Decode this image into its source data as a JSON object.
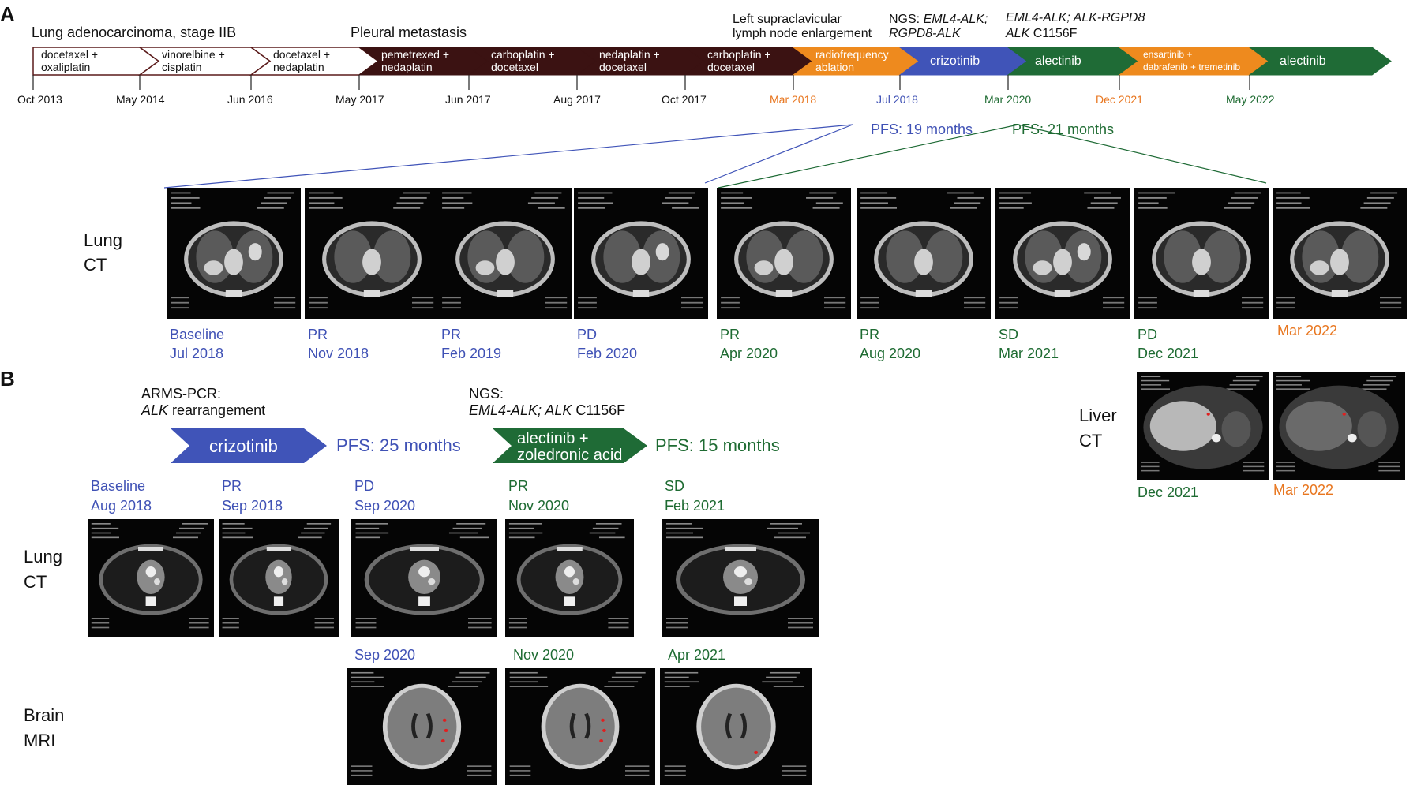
{
  "colors": {
    "brown": "#3b1212",
    "blue": "#4054b8",
    "green": "#1f6b36",
    "orange": "#ee8a1e",
    "blue_text": "#3f51b5",
    "green_text": "#1e6b32",
    "orange_text": "#e8761f"
  },
  "panel_a": {
    "label": "A",
    "header_labels": {
      "diagnosis": "Lung adenocarcinoma, stage IIB",
      "pleural": "Pleural metastasis",
      "lymph1": "Left supraclavicular",
      "lymph2": "lymph node enlargement",
      "ngs1_prefix": "NGS: ",
      "ngs1_gene": "EML4-ALK;",
      "ngs1_line2": "RGPD8-ALK",
      "ngs2_line1": "EML4-ALK; ALK-RGPD8",
      "ngs2_gene": "ALK",
      "ngs2_mut": " C1156F"
    },
    "arrows": [
      {
        "line1": "docetaxel +",
        "line2": "oxaliplatin",
        "style": "outline"
      },
      {
        "line1": "vinorelbine +",
        "line2": "cisplatin",
        "style": "outline"
      },
      {
        "line1": "docetaxel +",
        "line2": "nedaplatin",
        "style": "outline"
      },
      {
        "line1": "pemetrexed +",
        "line2": "nedaplatin",
        "style": "brown"
      },
      {
        "line1": "carboplatin +",
        "line2": "docetaxel",
        "style": "brown"
      },
      {
        "line1": "nedaplatin +",
        "line2": "docetaxel",
        "style": "brown"
      },
      {
        "line1": "carboplatin +",
        "line2": "docetaxel",
        "style": "brown"
      },
      {
        "line1": "radiofrequency",
        "line2": "ablation",
        "style": "orange"
      },
      {
        "line1": "crizotinib",
        "line2": "",
        "style": "blue"
      },
      {
        "line1": "alectinib",
        "line2": "",
        "style": "green"
      },
      {
        "line1": "ensartinib +",
        "line2": "dabrafenib + tremetinib",
        "style": "orange"
      },
      {
        "line1": "alectinib",
        "line2": "",
        "style": "green"
      }
    ],
    "dates": [
      {
        "label": "Oct 2013",
        "color": "black"
      },
      {
        "label": "May 2014",
        "color": "black"
      },
      {
        "label": "Jun 2016",
        "color": "black"
      },
      {
        "label": "May 2017",
        "color": "black"
      },
      {
        "label": "Jun 2017",
        "color": "black"
      },
      {
        "label": "Aug 2017",
        "color": "black"
      },
      {
        "label": "Oct 2017",
        "color": "black"
      },
      {
        "label": "Mar 2018",
        "color": "orange"
      },
      {
        "label": "Jul 2018",
        "color": "blue"
      },
      {
        "label": "Mar 2020",
        "color": "green"
      },
      {
        "label": "Dec 2021",
        "color": "orange"
      },
      {
        "label": "May 2022",
        "color": "green"
      }
    ],
    "pfs_blue": "PFS: 19 months",
    "pfs_green": "PFS: 21 months",
    "row_label_1": "Lung",
    "row_label_2": "CT",
    "scans": [
      {
        "status": "Baseline",
        "date": "Jul 2018",
        "color": "blue"
      },
      {
        "status": "PR",
        "date": "Nov 2018",
        "color": "blue"
      },
      {
        "status": "PR",
        "date": "Feb 2019",
        "color": "blue"
      },
      {
        "status": "PD",
        "date": "Feb 2020",
        "color": "blue"
      },
      {
        "status": "PR",
        "date": "Apr 2020",
        "color": "green"
      },
      {
        "status": "PR",
        "date": "Aug 2020",
        "color": "green"
      },
      {
        "status": "SD",
        "date": "Mar 2021",
        "color": "green"
      },
      {
        "status": "PD",
        "date": "Dec 2021",
        "color": "green"
      },
      {
        "status": "",
        "date": "Mar 2022",
        "color": "orange"
      }
    ]
  },
  "panel_b": {
    "label": "B",
    "arms_line1": "ARMS-PCR:",
    "arms_gene": "ALK",
    "arms_rest": " rearrangement",
    "ngs_line1": "NGS:",
    "ngs_gene": "EML4-ALK; ALK",
    "ngs_mut": " C1156F",
    "arrow1": "crizotinib",
    "pfs1": "PFS: 25 months",
    "arrow2_line1": "alectinib +",
    "arrow2_line2": "zoledronic acid",
    "pfs2": "PFS: 15 months",
    "lung_label_1": "Lung",
    "lung_label_2": "CT",
    "brain_label_1": "Brain",
    "brain_label_2": "MRI",
    "lung_scans": [
      {
        "status": "Baseline",
        "date": "Aug 2018",
        "color": "blue"
      },
      {
        "status": "PR",
        "date": "Sep 2018",
        "color": "blue"
      },
      {
        "status": "PD",
        "date": "Sep 2020",
        "color": "blue"
      },
      {
        "status": "PR",
        "date": "Nov 2020",
        "color": "green"
      },
      {
        "status": "SD",
        "date": "Feb 2021",
        "color": "green"
      }
    ],
    "brain_scans": [
      {
        "date": "Sep 2020",
        "color": "blue"
      },
      {
        "date": "Nov 2020",
        "color": "green"
      },
      {
        "date": "Apr 2021",
        "color": "green"
      }
    ],
    "liver_label_1": "Liver",
    "liver_label_2": "CT",
    "liver_scans": [
      {
        "date": "Dec 2021",
        "color": "green"
      },
      {
        "date": "Mar 2022",
        "color": "orange"
      }
    ]
  }
}
